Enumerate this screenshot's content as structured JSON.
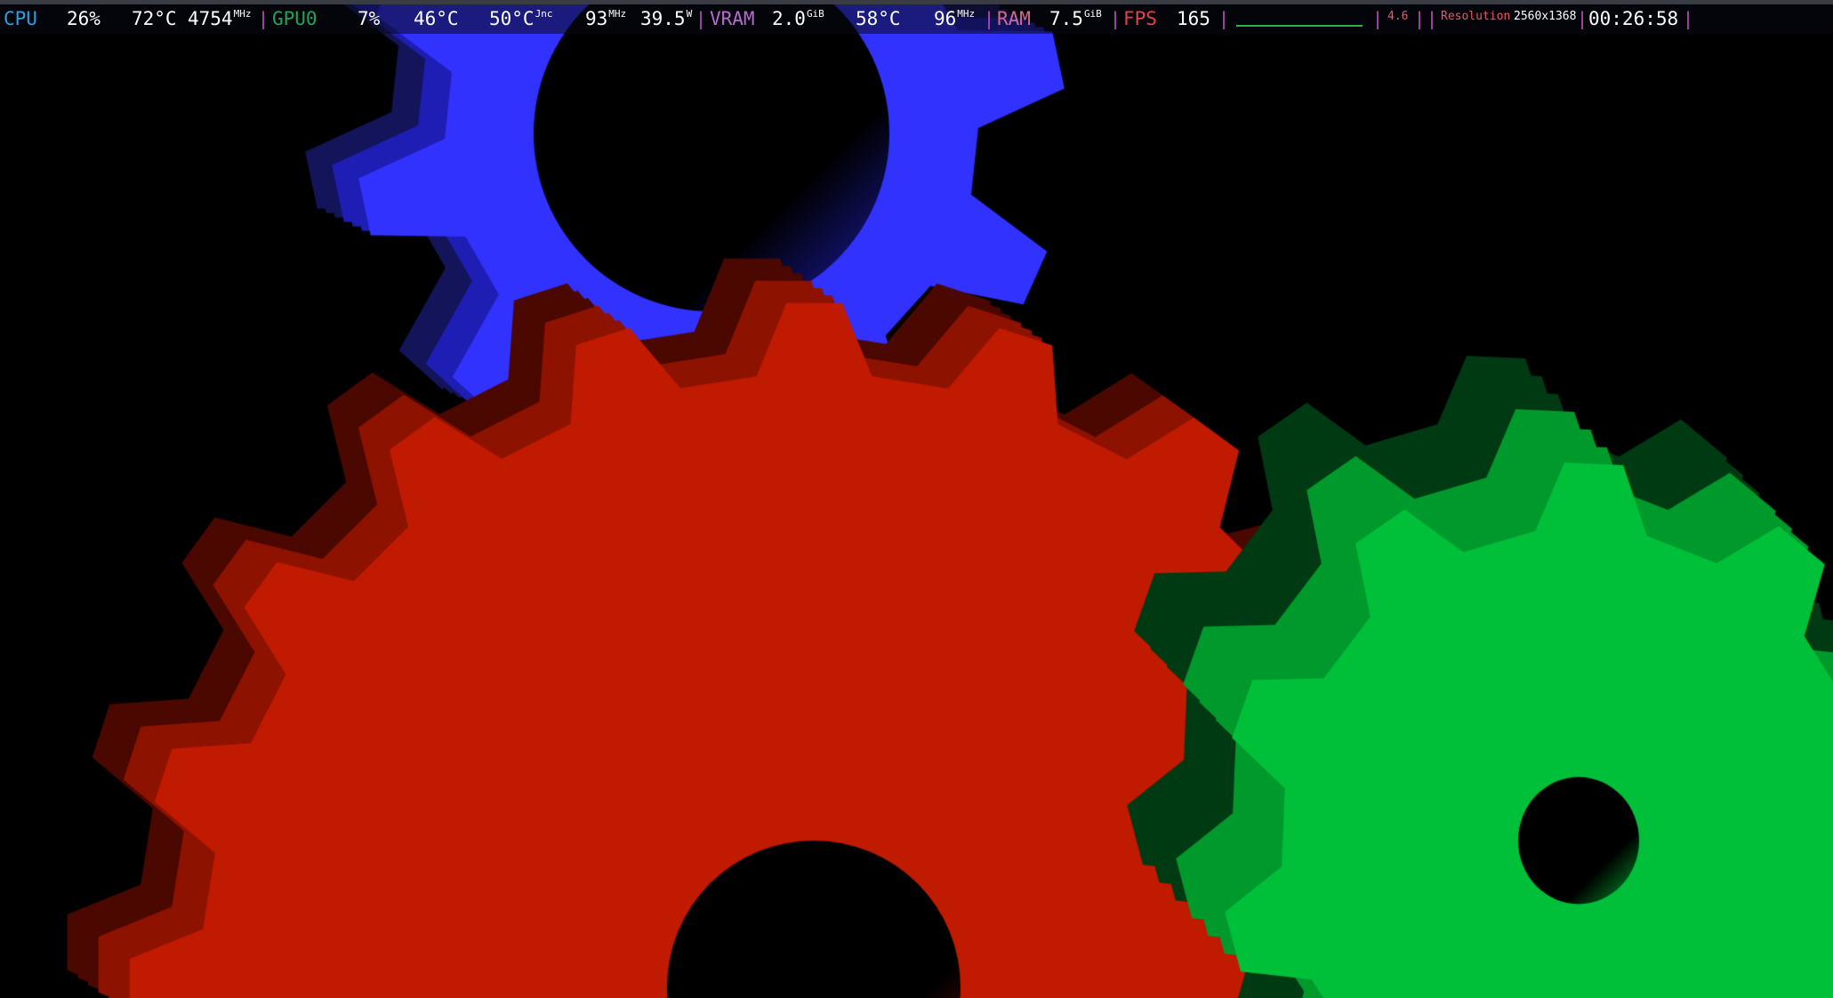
{
  "hud": {
    "cpu": {
      "label": "CPU",
      "load": "26%",
      "temp": "72°C",
      "clock": "4754",
      "clock_unit": "MHz"
    },
    "gpu": {
      "label": "GPU0",
      "load": "7%",
      "temp": "46°C",
      "junction_temp": "50°C",
      "junction_unit": "Jnc",
      "clock": "93",
      "clock_unit": "MHz",
      "power": "39.5",
      "power_unit": "W"
    },
    "vram": {
      "label": "VRAM",
      "used": "2.0",
      "used_unit": "GiB",
      "temp": "58°C",
      "clock": "96",
      "clock_unit": "MHz"
    },
    "ram": {
      "label": "RAM",
      "used": "7.5",
      "used_unit": "GiB"
    },
    "fps": {
      "label": "FPS",
      "value": "165"
    },
    "frametime": {
      "value": "4.6"
    },
    "resolution": {
      "label": "Resolution",
      "value": "2560x1368"
    },
    "clock": {
      "value": "00:26:58"
    },
    "separator": "|",
    "colors": {
      "cpu": "#2e9fe0",
      "gpu": "#1ea35a",
      "vram": "#b86bcc",
      "ram": "#d26a8c",
      "fps": "#e0434a",
      "frametime_graph": "#2ab34a",
      "separator": "#b44fb4",
      "value": "#ffffff",
      "small_label": "#e65a6a"
    }
  },
  "scene": {
    "background": "#000000",
    "gears": [
      {
        "name": "red-gear",
        "face": "#c01a00",
        "side": "#8e1200",
        "shadow": "#4a0800"
      },
      {
        "name": "green-gear",
        "face": "#00c03a",
        "side": "#009a2c",
        "shadow": "#003a12"
      },
      {
        "name": "blue-gear",
        "face": "#3232ff",
        "side": "#1e1eb4",
        "shadow": "#14145a"
      }
    ]
  }
}
